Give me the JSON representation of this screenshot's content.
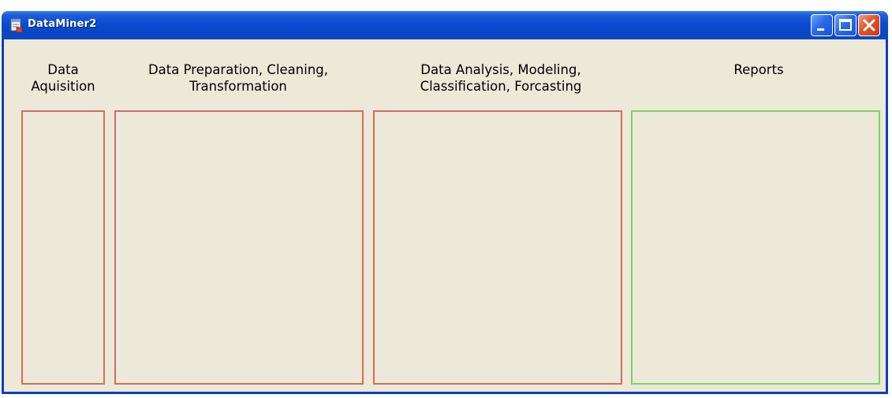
{
  "window": {
    "title": "DataMiner2"
  },
  "titlebar_controls": {
    "minimize": "minimize-icon",
    "maximize": "maximize-icon",
    "close": "close-icon"
  },
  "sections": {
    "aquisition": {
      "heading": "Data\nAquisition",
      "border_color": "#d96a5f"
    },
    "preparation": {
      "heading": "Data Preparation, Cleaning,\nTransformation",
      "border_color": "#d96a5f"
    },
    "analysis": {
      "heading": "Data Analysis, Modeling,\nClassification, Forcasting",
      "border_color": "#d96a5f"
    },
    "reports": {
      "heading": "Reports",
      "border_color": "#7cd26a"
    }
  },
  "colors": {
    "titlebar": "#0b4bd0",
    "window_bg": "#ece9d8",
    "panel_border_red": "#d96a5f",
    "panel_border_green": "#7cd26a"
  }
}
